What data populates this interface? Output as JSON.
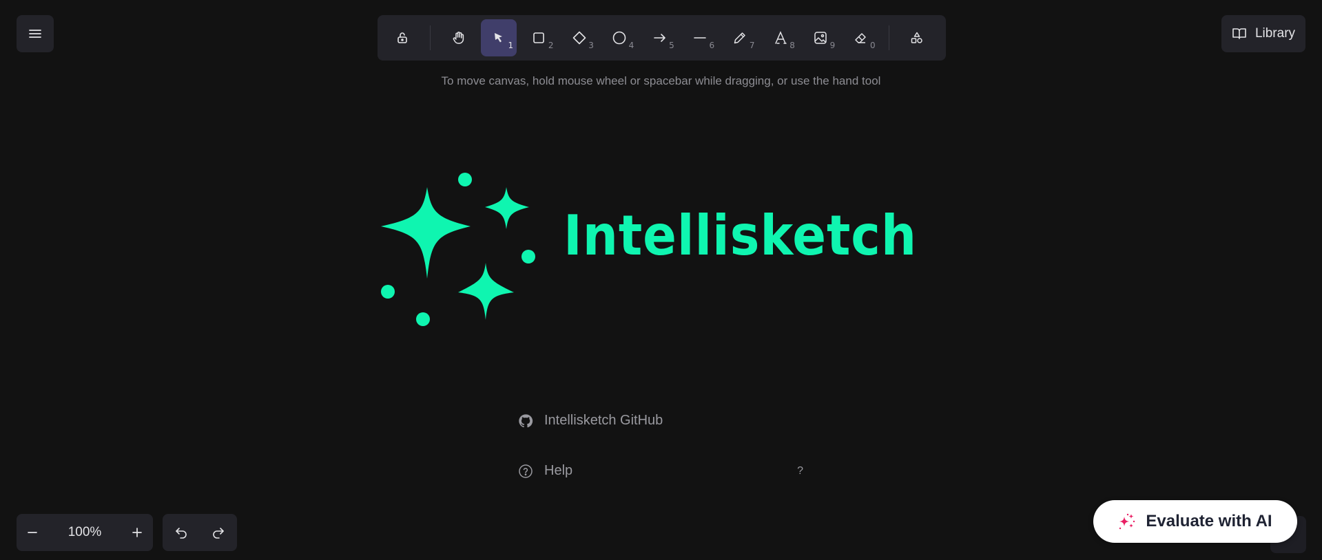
{
  "app": {
    "brand_name": "Intellisketch",
    "accent_color": "#0ff5b0"
  },
  "toolbar": {
    "tools": [
      {
        "name": "lock",
        "icon": "lock-icon",
        "shortcut": ""
      },
      {
        "name": "hand",
        "icon": "hand-icon",
        "shortcut": ""
      },
      {
        "name": "selection",
        "icon": "pointer-icon",
        "shortcut": "1",
        "active": true
      },
      {
        "name": "rectangle",
        "icon": "rectangle-icon",
        "shortcut": "2"
      },
      {
        "name": "diamond",
        "icon": "diamond-icon",
        "shortcut": "3"
      },
      {
        "name": "ellipse",
        "icon": "ellipse-icon",
        "shortcut": "4"
      },
      {
        "name": "arrow",
        "icon": "arrow-icon",
        "shortcut": "5"
      },
      {
        "name": "line",
        "icon": "line-icon",
        "shortcut": "6"
      },
      {
        "name": "draw",
        "icon": "pencil-icon",
        "shortcut": "7"
      },
      {
        "name": "text",
        "icon": "text-icon",
        "shortcut": "8"
      },
      {
        "name": "image",
        "icon": "image-icon",
        "shortcut": "9"
      },
      {
        "name": "eraser",
        "icon": "eraser-icon",
        "shortcut": "0"
      },
      {
        "name": "extra-tools",
        "icon": "shapes-icon",
        "shortcut": ""
      }
    ]
  },
  "library": {
    "label": "Library"
  },
  "hint": {
    "text": "To move canvas, hold mouse wheel or spacebar while dragging, or use the hand tool"
  },
  "welcome": {
    "links": [
      {
        "label": "Intellisketch GitHub",
        "icon": "github-icon",
        "shortcut": ""
      },
      {
        "label": "Help",
        "icon": "help-icon",
        "shortcut": "?"
      }
    ]
  },
  "zoom": {
    "level": "100%"
  },
  "evaluate": {
    "label": "Evaluate with AI"
  }
}
